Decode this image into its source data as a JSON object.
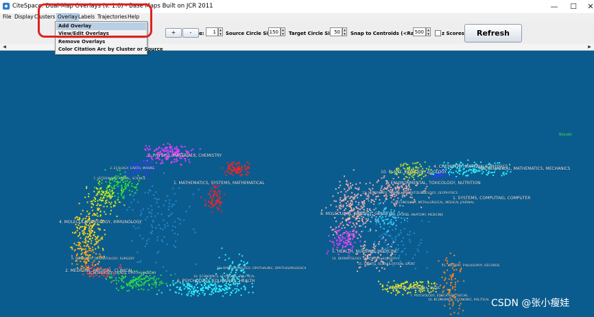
{
  "window": {
    "title": "CiteSpace: Dual-Map Overlays (v. 1.8) - Base Maps Built on JCR 2011",
    "minimize": "—",
    "maximize": "☐",
    "close": "✕"
  },
  "menu": {
    "file": "File",
    "display": "Display",
    "clusters": "Clusters",
    "overlay": "Overlay",
    "labels": "Labels",
    "trajectories": "Trajectories",
    "help": "Help"
  },
  "overlay_menu": {
    "add_overlay": "Add Overlay",
    "view_edit_overlays": "View/Edit Overlays",
    "remove_overlays": "Remove Overlays",
    "color_citation_arc": "Color Citation Arc by Cluster or Source"
  },
  "toolbar": {
    "plus_label": "+",
    "minus_label": "-",
    "alpha_label": "α:",
    "alpha_value": "1",
    "source_circle_label": "Source Circle Size:",
    "source_circle_value": "150",
    "target_circle_label": "Target Circle Size:",
    "target_circle_value": "50",
    "snap_label": "Snap to Centroids (<Radius):",
    "snap_value": "500",
    "zscores_label": "z Scores",
    "refresh_label": "Refresh"
  },
  "map": {
    "legend_text": "Blondel",
    "left_labels": {
      "l5": "5. PHYSICS, MATERIALS, CHEMISTRY",
      "l3": "3. ECOLOGY, EARTH, MARINE",
      "l7": "7. VETERINARY, ANIMAL, SCIENCE",
      "l1": "1. MATHEMATICS, SYSTEMS, MATHEMATICAL",
      "l4": "4. MOLECULAR, BIOLOGY, IMMUNOLOGY",
      "l9": "9. DENTISTRY, DERMATOLOGY, SURGERY",
      "l2": "2. MEDICINE, MEDICAL, CLINICAL",
      "l8": "8. NEUROLOGY, SPORTS, OPHTHALMOLOGY",
      "l6": "6. PSYCHOLOGY, EDUCATION, HEALTH",
      "l10": "10. ECONOMICS, ECONOMIC, POLITICAL",
      "l11": "11. OPHTHALMOLOGY, OPHTHALMIC, OPHTHALMOLOGICA"
    },
    "right_labels": {
      "r4": "4. CHEMISTRY, MATERIALS, PHYSICS",
      "r10": "10. PLANT, ECOLOGY, ZOOLOGY",
      "r2": "2. ENVIRONMENTAL, TOXICOLOGY, NUTRITION",
      "r12": "12. VETERINARY, ANIMAL, PARASITOLOGY",
      "r_math": "MATHEMATICAL, MATHEMATICS, MECHANICS",
      "r1": "1. SYSTEMS, COMPUTING, COMPUTER",
      "r3": "3. GEOLOGY, GEOPHYSICS",
      "r6": "6. TECHNOLOGY, METALLURGICAL, MEDICAL JOURNAL",
      "r8": "8. MOLECULAR, BIOLOGY, GENETICS",
      "r9": "9. SPORTS, ANATOMY, MEDICINE",
      "r5": "5. HEALTH, NURSING, MEDICINE",
      "r14": "14. DERMATOLOGY, DENTISTRY, SURGERY",
      "r15": "15. SPORTS, REHABILITATION, SPORT",
      "r11": "11. HISTORY, PHILOSOPHY, RECORDS",
      "r13": "13. REVISTA, PSICOLOGIA, SAUDE",
      "r7": "7. PSYCHOLOGY, EDUCATION, SOCIAL",
      "r16": "16. ECONOMICS, ECONOMIC, POLITICAL"
    },
    "watermark": "CSDN @张小瘦娃"
  },
  "colors": {
    "canvas_bg": "#0b5c8e",
    "highlight": "#e02020",
    "menu_hover": "#b8cfe5"
  }
}
